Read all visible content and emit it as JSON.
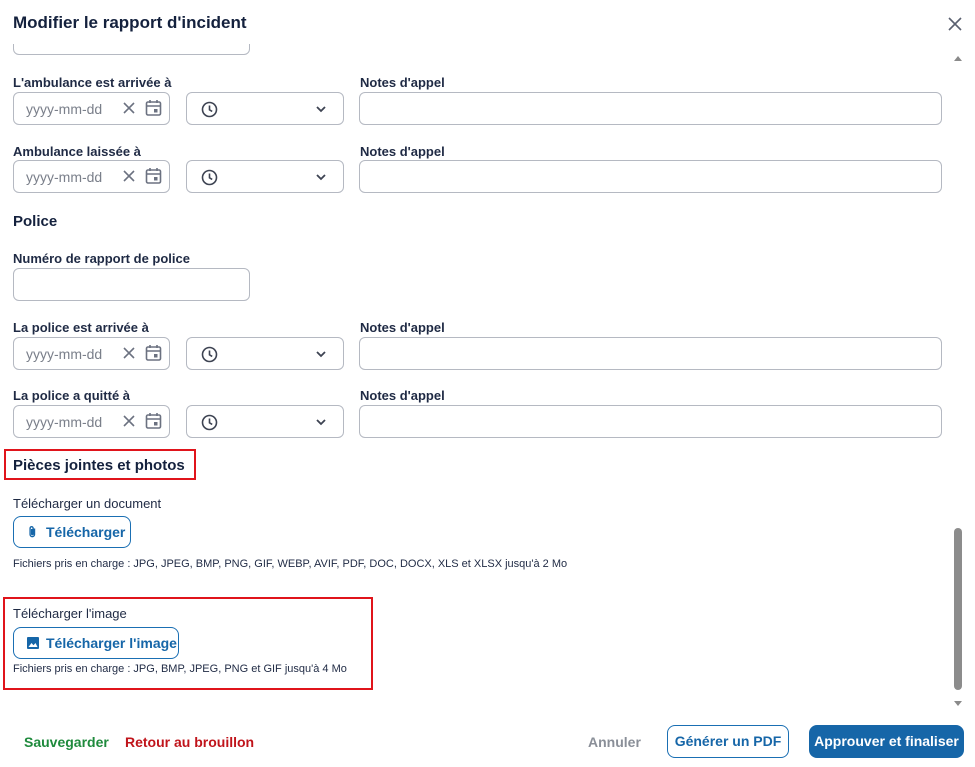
{
  "dialog": {
    "title": "Modifier le rapport d'incident"
  },
  "ambulance": {
    "arrived_label": "L'ambulance est arrivée à",
    "left_label": "Ambulance laissée à",
    "notes_label_1": "Notes d'appel",
    "notes_label_2": "Notes d'appel",
    "date_placeholder": "yyyy-mm-dd"
  },
  "police": {
    "title": "Police",
    "report_number_label": "Numéro de rapport de police",
    "arrived_label": "La police est arrivée à",
    "left_label": "La police a quitté à",
    "notes_label_1": "Notes d'appel",
    "notes_label_2": "Notes d'appel",
    "date_placeholder": "yyyy-mm-dd"
  },
  "attachments": {
    "title": "Pièces jointes et photos",
    "document_label": "Télécharger un document",
    "document_button": "Télécharger",
    "document_help": "Fichiers pris en charge : JPG, JPEG, BMP, PNG, GIF, WEBP, AVIF, PDF, DOC, DOCX, XLS et XLSX jusqu'à 2 Mo",
    "image_label": "Télécharger l'image",
    "image_button": "Télécharger l'image",
    "image_help": "Fichiers pris en charge : JPG, BMP, JPEG, PNG et GIF jusqu'à 4 Mo"
  },
  "footer": {
    "save": "Sauvegarder",
    "back_to_draft": "Retour au brouillon",
    "cancel": "Annuler",
    "generate_pdf": "Générer un PDF",
    "approve": "Approuver et finaliser"
  },
  "colors": {
    "accent": "#1666a8",
    "save": "#1e8a3c",
    "back": "#c0141b",
    "cancel": "#8a8f98",
    "highlight": "#e0141b"
  },
  "icons": {
    "close": "close-icon",
    "clear": "clear-icon",
    "calendar": "calendar-icon",
    "clock": "clock-icon",
    "chevron": "chevron-down-icon",
    "attach": "paperclip-icon",
    "image": "image-icon"
  }
}
